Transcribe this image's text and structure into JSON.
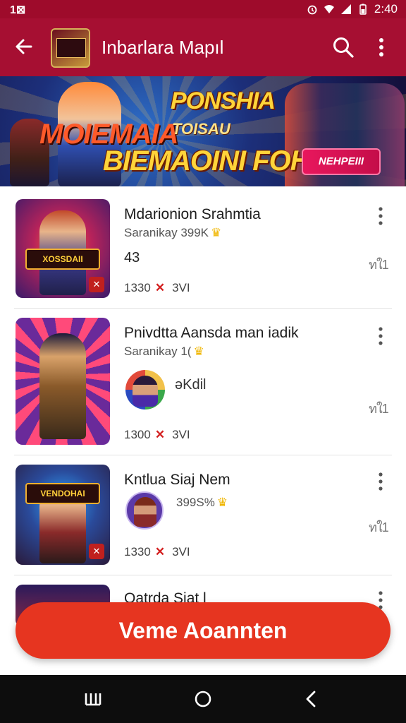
{
  "status_bar": {
    "time_left": "1⊠",
    "time_right": "2:40"
  },
  "app_bar": {
    "title": "Inbarlara Mapıl"
  },
  "banner": {
    "line1": "PONSHIA",
    "line2": "MOIEMAIA",
    "line_sub": "TOISAU",
    "line3": "BIEMAOINI FOHNIS",
    "cta": "NEHPEIII"
  },
  "items": [
    {
      "title": "Mdarionion Srahmtia",
      "subtitle": "Saranikay 399K",
      "extra": "43",
      "stats_left": "1330",
      "stats_right": "3VI",
      "thumb_badge": "XOSSDAII",
      "share": "ทใ1"
    },
    {
      "title": "Pnivdtta Aansda man iadik",
      "subtitle": "Saranikay 1(",
      "handle": "əKdil",
      "stats_left": "1300",
      "stats_right": "3VI",
      "share": "ทใ1"
    },
    {
      "title": "Kntlua Siaj   Nem",
      "subtitle": "399S%",
      "stats_left": "1330",
      "stats_right": "3VI",
      "thumb_badge": "VENDOHAI",
      "share": "ทใ1"
    },
    {
      "title": "Oatrda Siat   l"
    }
  ],
  "fab": {
    "label": "Veme Aoannten"
  },
  "colors": {
    "app_bar": "#a60f32",
    "fab": "#e63520",
    "nav_bar": "#0d0d0d"
  }
}
